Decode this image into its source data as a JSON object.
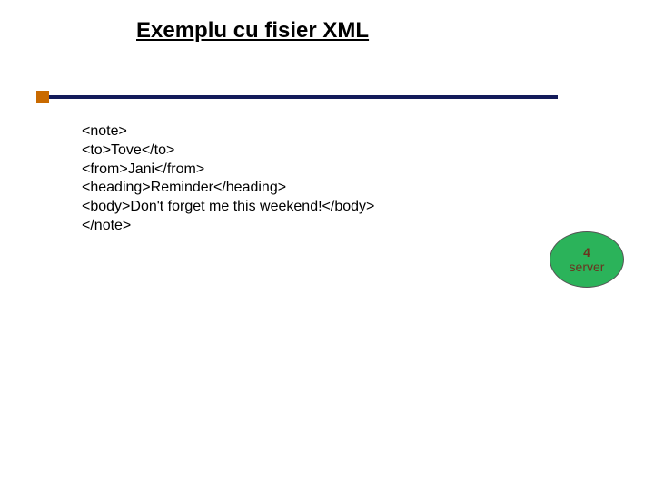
{
  "slide": {
    "title": "Exemplu cu fisier XML",
    "xml_lines": {
      "l0": "<note>",
      "l1": "<to>Tove</to>",
      "l2": "<from>Jani</from>",
      "l3": "<heading>Reminder</heading>",
      "l4": "<body>Don't forget me this weekend!</body>",
      "l5": "</note>"
    },
    "badge": {
      "number": "4",
      "label": "server"
    }
  }
}
